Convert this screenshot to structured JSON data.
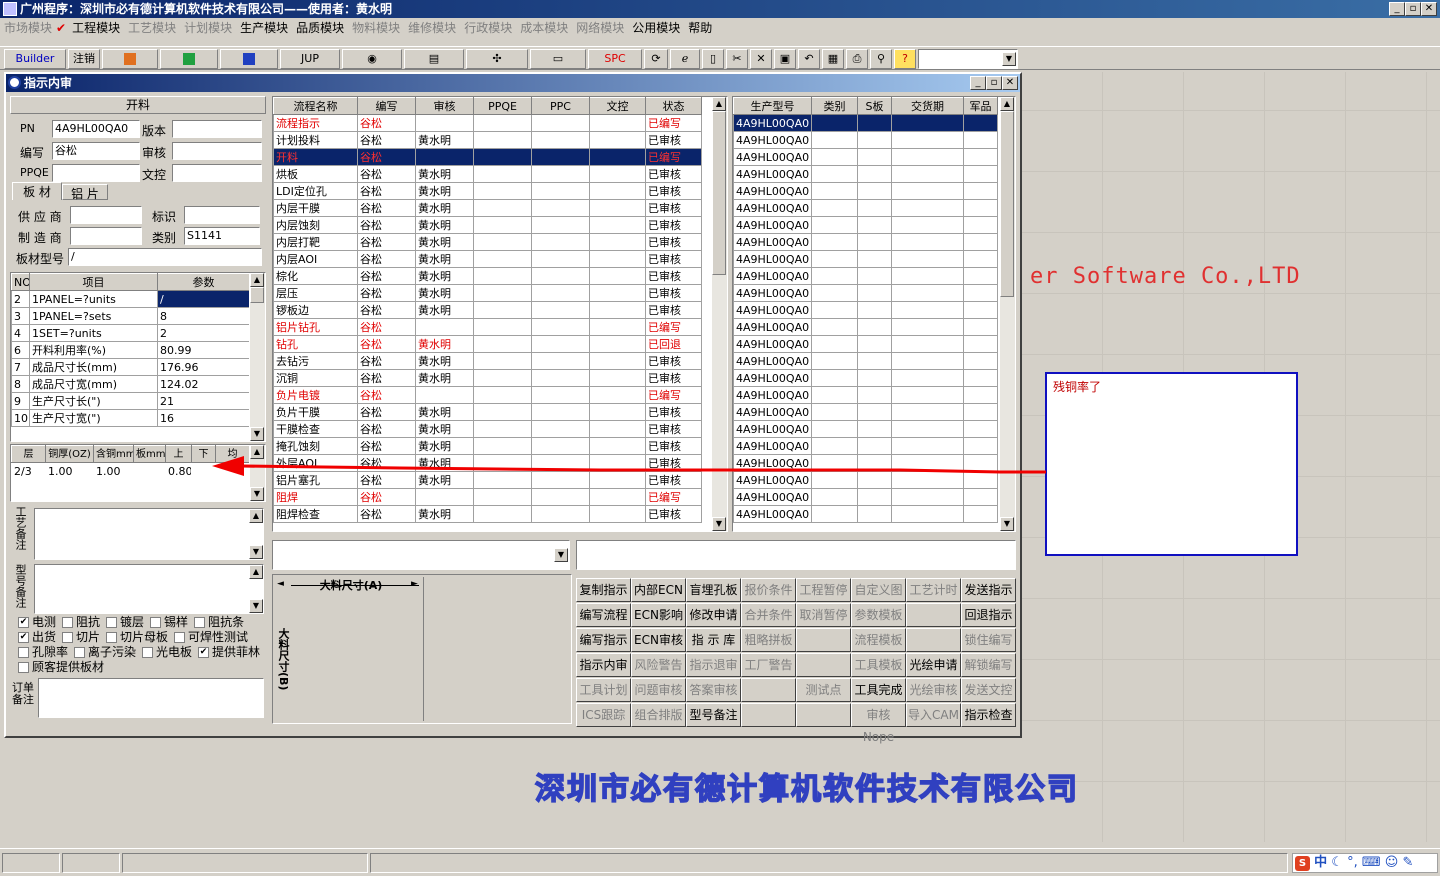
{
  "window": {
    "title": "广州程序：深圳市必有德计算机软件技术有限公司——使用者：黄水明"
  },
  "menu": [
    {
      "label": "市场模块",
      "enabled": false
    },
    {
      "label": "工程模块",
      "enabled": true,
      "checked": true
    },
    {
      "label": "工艺模块",
      "enabled": false
    },
    {
      "label": "计划模块",
      "enabled": false
    },
    {
      "label": "生产模块",
      "enabled": true
    },
    {
      "label": "品质模块",
      "enabled": true
    },
    {
      "label": "物料模块",
      "enabled": false
    },
    {
      "label": "维修模块",
      "enabled": false
    },
    {
      "label": "行政模块",
      "enabled": false
    },
    {
      "label": "成本模块",
      "enabled": false
    },
    {
      "label": "网络模块",
      "enabled": false
    },
    {
      "label": "公用模块",
      "enabled": true
    },
    {
      "label": "帮助",
      "enabled": true
    }
  ],
  "toolbar": {
    "builder": "Builder",
    "cancel": "注销",
    "jup": "JUP",
    "spc": "SPC"
  },
  "child": {
    "title": "指示内审"
  },
  "left": {
    "header": "开料",
    "pn_label": "PN",
    "pn_value": "4A9HL00QA0",
    "version_label": "版本",
    "version_value": "",
    "author_label": "编写",
    "author_value": "谷松",
    "review_label": "审核",
    "review_value": "",
    "ppqe_label": "PPQE",
    "ppqe_value": "",
    "doc_label": "文控",
    "doc_value": "",
    "tabs": [
      "板 材",
      "铝 片"
    ],
    "supplier_label": "供 应 商",
    "supplier_value": "",
    "mark_label": "标识",
    "mark_value": "",
    "maker_label": "制 造 商",
    "maker_value": "",
    "category_label": "类别",
    "category_value": "S1141",
    "model_label": "板材型号",
    "model_value": "/",
    "param_headers": [
      "NO",
      "项目",
      "参数"
    ],
    "params": [
      {
        "no": "2",
        "item": "1PANEL=?units",
        "val": "/"
      },
      {
        "no": "3",
        "item": "1PANEL=?sets",
        "val": "8"
      },
      {
        "no": "4",
        "item": "1SET=?units",
        "val": "2"
      },
      {
        "no": "6",
        "item": "开料利用率(%)",
        "val": "80.99"
      },
      {
        "no": "7",
        "item": "成品尺寸长(mm)",
        "val": "176.96"
      },
      {
        "no": "8",
        "item": "成品尺寸宽(mm)",
        "val": "124.02"
      },
      {
        "no": "9",
        "item": "生产尺寸长(\")",
        "val": "21"
      },
      {
        "no": "10",
        "item": "生产尺寸宽(\")",
        "val": "16"
      }
    ],
    "layer_headers": [
      "层",
      "铜厚(OZ)",
      "含铜mm",
      "板mm",
      "上",
      "下",
      "均"
    ],
    "layer_row": [
      "2/3",
      "1.00",
      "1.00",
      "",
      "0.80",
      "",
      ""
    ],
    "process_note_label": "工艺备注",
    "model_note_label": "型号备注",
    "checks": [
      [
        {
          "label": "电测",
          "on": true
        },
        {
          "label": "阻抗",
          "on": false
        },
        {
          "label": "镀层",
          "on": false
        },
        {
          "label": "锡样",
          "on": false
        },
        {
          "label": "阻抗条",
          "on": false
        }
      ],
      [
        {
          "label": "出货",
          "on": true
        },
        {
          "label": "切片",
          "on": false
        },
        {
          "label": "切片母板",
          "on": false
        },
        {
          "label": "可焊性测试",
          "on": false
        }
      ],
      [
        {
          "label": "孔隙率",
          "on": false
        },
        {
          "label": "离子污染",
          "on": false
        },
        {
          "label": "光电板",
          "on": false
        },
        {
          "label": "提供菲林",
          "on": true
        }
      ],
      [
        {
          "label": "顾客提供板材",
          "on": false
        }
      ]
    ],
    "order_note_label": "订单备注"
  },
  "flow": {
    "headers": [
      "流程名称",
      "编写",
      "审核",
      "PPQE",
      "PPC",
      "文控",
      "状态"
    ],
    "rows": [
      {
        "name": "流程指示",
        "author": "谷松",
        "reviewer": "",
        "status": "已编写",
        "red": true
      },
      {
        "name": "计划投料",
        "author": "谷松",
        "reviewer": "黄水明",
        "status": "已审核",
        "red": false
      },
      {
        "name": "开料",
        "author": "谷松",
        "reviewer": "",
        "status": "已编写",
        "red": true,
        "selected": true
      },
      {
        "name": "烘板",
        "author": "谷松",
        "reviewer": "黄水明",
        "status": "已审核",
        "red": false
      },
      {
        "name": "LDI定位孔",
        "author": "谷松",
        "reviewer": "黄水明",
        "status": "已审核",
        "red": false
      },
      {
        "name": "内层干膜",
        "author": "谷松",
        "reviewer": "黄水明",
        "status": "已审核",
        "red": false
      },
      {
        "name": "内层蚀刻",
        "author": "谷松",
        "reviewer": "黄水明",
        "status": "已审核",
        "red": false
      },
      {
        "name": "内层打靶",
        "author": "谷松",
        "reviewer": "黄水明",
        "status": "已审核",
        "red": false
      },
      {
        "name": "内层AOI",
        "author": "谷松",
        "reviewer": "黄水明",
        "status": "已审核",
        "red": false
      },
      {
        "name": "棕化",
        "author": "谷松",
        "reviewer": "黄水明",
        "status": "已审核",
        "red": false
      },
      {
        "name": "层压",
        "author": "谷松",
        "reviewer": "黄水明",
        "status": "已审核",
        "red": false
      },
      {
        "name": "锣板边",
        "author": "谷松",
        "reviewer": "黄水明",
        "status": "已审核",
        "red": false
      },
      {
        "name": "铝片钻孔",
        "author": "谷松",
        "reviewer": "",
        "status": "已编写",
        "red": true
      },
      {
        "name": "钻孔",
        "author": "谷松",
        "reviewer": "黄水明",
        "status": "已回退",
        "red": true
      },
      {
        "name": "去钻污",
        "author": "谷松",
        "reviewer": "黄水明",
        "status": "已审核",
        "red": false
      },
      {
        "name": "沉铜",
        "author": "谷松",
        "reviewer": "黄水明",
        "status": "已审核",
        "red": false
      },
      {
        "name": "负片电镀",
        "author": "谷松",
        "reviewer": "",
        "status": "已编写",
        "red": true
      },
      {
        "name": "负片干膜",
        "author": "谷松",
        "reviewer": "黄水明",
        "status": "已审核",
        "red": false
      },
      {
        "name": "干膜检查",
        "author": "谷松",
        "reviewer": "黄水明",
        "status": "已审核",
        "red": false
      },
      {
        "name": "掩孔蚀刻",
        "author": "谷松",
        "reviewer": "黄水明",
        "status": "已审核",
        "red": false
      },
      {
        "name": "外层AOI",
        "author": "谷松",
        "reviewer": "黄水明",
        "status": "已审核",
        "red": false
      },
      {
        "name": "铝片塞孔",
        "author": "谷松",
        "reviewer": "黄水明",
        "status": "已审核",
        "red": false
      },
      {
        "name": "阻焊",
        "author": "谷松",
        "reviewer": "",
        "status": "已编写",
        "red": true
      },
      {
        "name": "阻焊检查",
        "author": "谷松",
        "reviewer": "黄水明",
        "status": "已审核",
        "red": false
      }
    ]
  },
  "models": {
    "headers": [
      "生产型号",
      "类别",
      "S板",
      "交货期",
      "军品"
    ],
    "value": "4A9HL00QA0",
    "count": 24
  },
  "size": {
    "a_label": "大料尺寸(A)",
    "b_label": "大料尺寸(B)"
  },
  "buttons": [
    [
      {
        "l": "复制指示",
        "e": true
      },
      {
        "l": "内部ECN",
        "e": true
      },
      {
        "l": "盲埋孔板",
        "e": true
      },
      {
        "l": "报价条件",
        "e": false
      },
      {
        "l": "工程暂停",
        "e": false
      },
      {
        "l": "自定义图",
        "e": false
      },
      {
        "l": "工艺计时",
        "e": false
      },
      {
        "l": "发送指示",
        "e": true
      }
    ],
    [
      {
        "l": "编写流程",
        "e": true
      },
      {
        "l": "ECN影响",
        "e": true
      },
      {
        "l": "修改申请",
        "e": true
      },
      {
        "l": "合并条件",
        "e": false
      },
      {
        "l": "取消暂停",
        "e": false
      },
      {
        "l": "参数模板",
        "e": false
      },
      {
        "l": "",
        "e": false
      },
      {
        "l": "回退指示",
        "e": true
      }
    ],
    [
      {
        "l": "编写指示",
        "e": true
      },
      {
        "l": "ECN审核",
        "e": true
      },
      {
        "l": "指 示 库",
        "e": true
      },
      {
        "l": "粗略拼板",
        "e": false
      },
      {
        "l": "",
        "e": false
      },
      {
        "l": "流程模板",
        "e": false
      },
      {
        "l": "",
        "e": false
      },
      {
        "l": "锁住编写",
        "e": false
      }
    ],
    [
      {
        "l": "指示内审",
        "e": true
      },
      {
        "l": "风险警告",
        "e": false
      },
      {
        "l": "指示退审",
        "e": false
      },
      {
        "l": "工厂警告",
        "e": false
      },
      {
        "l": "",
        "e": false
      },
      {
        "l": "工具模板",
        "e": false
      },
      {
        "l": "光绘申请",
        "e": true
      },
      {
        "l": "解锁编写",
        "e": false
      }
    ],
    [
      {
        "l": "工具计划",
        "e": false
      },
      {
        "l": "问题审核",
        "e": false
      },
      {
        "l": "答案审核",
        "e": false
      },
      {
        "l": "",
        "e": false
      },
      {
        "l": "测试点",
        "e": false
      },
      {
        "l": "工具完成",
        "e": true
      },
      {
        "l": "光绘审核",
        "e": false
      },
      {
        "l": "发送文控",
        "e": false
      }
    ],
    [
      {
        "l": "ICS跟踪",
        "e": false
      },
      {
        "l": "组合排版",
        "e": false
      },
      {
        "l": "型号备注",
        "e": true
      },
      {
        "l": "",
        "e": false
      },
      {
        "l": "",
        "e": false
      },
      {
        "l": "审核Nope",
        "e": false
      },
      {
        "l": "导入CAM",
        "e": false
      },
      {
        "l": "指示检查",
        "e": true
      }
    ]
  ],
  "annotation": {
    "text": "残铜率了"
  },
  "background": {
    "company": "深圳市必有德计算机软件技术有限公司",
    "english": "er Software Co.,LTD"
  },
  "tray": {
    "ime": "中"
  }
}
